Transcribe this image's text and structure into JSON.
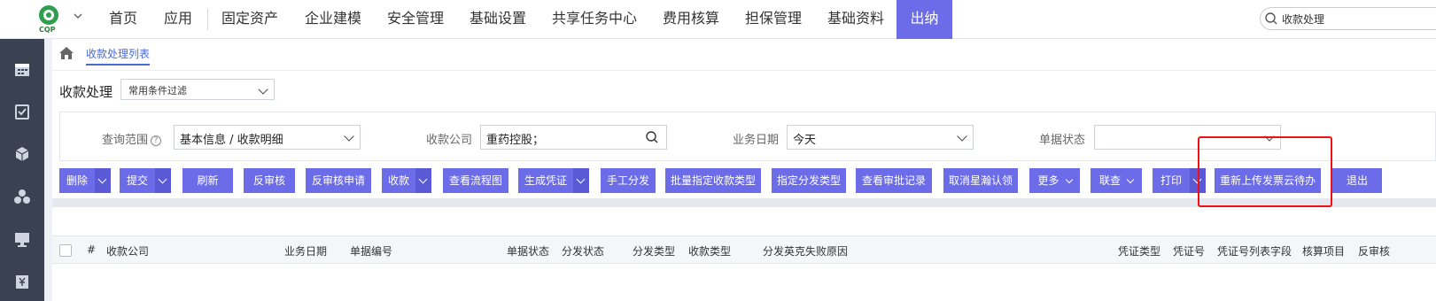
{
  "logo": {
    "text": "CQP"
  },
  "nav": {
    "items": [
      "首页",
      "应用",
      "固定资产",
      "企业建模",
      "安全管理",
      "基础设置",
      "共享任务中心",
      "费用核算",
      "担保管理",
      "基础资料"
    ],
    "active": "出纳"
  },
  "search": {
    "value": "收款处理"
  },
  "breadcrumb": {
    "tab": "收款处理列表"
  },
  "page": {
    "title": "收款处理",
    "filter_value": "常用条件过滤"
  },
  "query": {
    "scope_label": "查询范围",
    "scope_value": "基本信息 / 收款明细",
    "company_label": "收款公司",
    "company_value": "重药控股；",
    "date_label": "业务日期",
    "date_value": "今天",
    "status_label": "单据状态",
    "status_value": ""
  },
  "toolbar": {
    "delete": "删除",
    "submit": "提交",
    "refresh": "刷新",
    "unaudit": "反审核",
    "unaudit_apply": "反审核申请",
    "collect": "收款",
    "view_flow": "查看流程图",
    "gen_voucher": "生成凭证",
    "manual_dist": "手工分发",
    "batch_type": "批量指定收款类型",
    "dist_type": "指定分发类型",
    "view_audit": "查看审批记录",
    "cancel_claim": "取消星瀚认领",
    "more": "更多",
    "linked": "联查",
    "print": "打印",
    "reupload": "重新上传发票云待办",
    "exit": "退出"
  },
  "table": {
    "headers": [
      "#",
      "收款公司",
      "业务日期",
      "单据编号",
      "单据状态",
      "分发状态",
      "分发类型",
      "收款类型",
      "分发英克失败原因",
      "凭证类型",
      "凭证号",
      "凭证号列表字段",
      "核算项目",
      "反审核"
    ]
  },
  "colors": {
    "accent": "#6c6ce8",
    "sidebar": "#3a4152",
    "highlight_box": "#ee1111"
  }
}
